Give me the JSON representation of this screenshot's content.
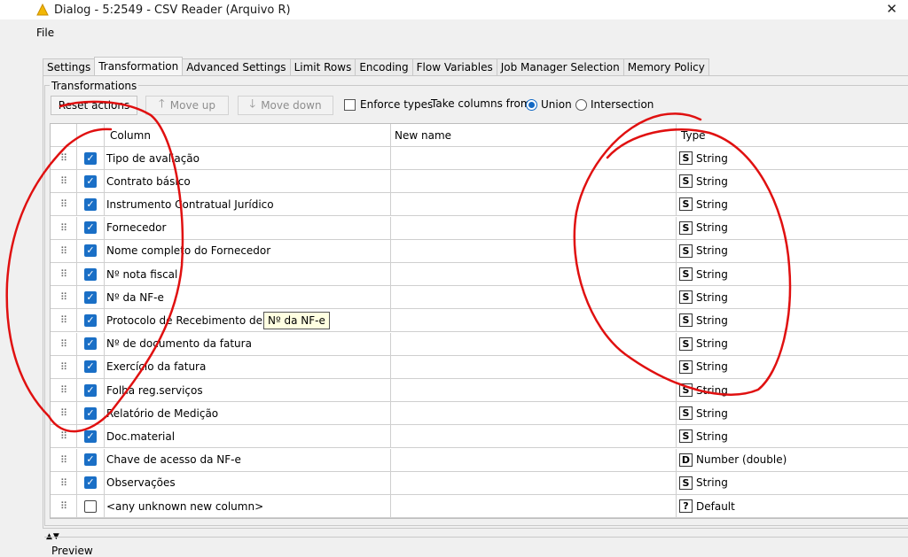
{
  "window": {
    "title": "Dialog - 5:2549 - CSV Reader (Arquivo R)",
    "close_label": "✕"
  },
  "menu": {
    "file": "File"
  },
  "tabs": [
    {
      "label": "Settings"
    },
    {
      "label": "Transformation",
      "active": true
    },
    {
      "label": "Advanced Settings"
    },
    {
      "label": "Limit Rows"
    },
    {
      "label": "Encoding"
    },
    {
      "label": "Flow Variables"
    },
    {
      "label": "Job Manager Selection"
    },
    {
      "label": "Memory Policy"
    }
  ],
  "transformations": {
    "group_title": "Transformations",
    "reset_label": "Reset actions",
    "move_up_label": "Move up",
    "move_down_label": "Move down",
    "enforce_types_label": "Enforce types",
    "enforce_types_checked": false,
    "take_columns_label": "Take columns from:",
    "union_label": "Union",
    "intersection_label": "Intersection",
    "selected_mode": "Union"
  },
  "table": {
    "headers": {
      "column": "Column",
      "new_name": "New name",
      "type": "Type"
    },
    "rows": [
      {
        "checked": true,
        "column": "Tipo de avaliação",
        "new_name": "",
        "type_icon": "S",
        "type": "String"
      },
      {
        "checked": true,
        "column": "Contrato básico",
        "new_name": "",
        "type_icon": "S",
        "type": "String"
      },
      {
        "checked": true,
        "column": "Instrumento Contratual Jurídico",
        "new_name": "",
        "type_icon": "S",
        "type": "String"
      },
      {
        "checked": true,
        "column": "Fornecedor",
        "new_name": "",
        "type_icon": "S",
        "type": "String"
      },
      {
        "checked": true,
        "column": "Nome completo do Fornecedor",
        "new_name": "",
        "type_icon": "S",
        "type": "String"
      },
      {
        "checked": true,
        "column": "Nº nota fiscal",
        "new_name": "",
        "type_icon": "S",
        "type": "String"
      },
      {
        "checked": true,
        "column": "Nº da NF-e",
        "new_name": "",
        "type_icon": "S",
        "type": "String"
      },
      {
        "checked": true,
        "column": "Protocolo de Recebimento de Nota",
        "new_name": "",
        "type_icon": "S",
        "type": "String"
      },
      {
        "checked": true,
        "column": "Nº de documento da fatura",
        "new_name": "",
        "type_icon": "S",
        "type": "String"
      },
      {
        "checked": true,
        "column": "Exercício da fatura",
        "new_name": "",
        "type_icon": "S",
        "type": "String"
      },
      {
        "checked": true,
        "column": "Folha reg.serviços",
        "new_name": "",
        "type_icon": "S",
        "type": "String"
      },
      {
        "checked": true,
        "column": "Relatório de Medição",
        "new_name": "",
        "type_icon": "S",
        "type": "String"
      },
      {
        "checked": true,
        "column": "Doc.material",
        "new_name": "",
        "type_icon": "S",
        "type": "String"
      },
      {
        "checked": true,
        "column": "Chave de acesso da NF-e",
        "new_name": "",
        "type_icon": "D",
        "type": "Number (double)"
      },
      {
        "checked": true,
        "column": "Observações",
        "new_name": "",
        "type_icon": "S",
        "type": "String"
      },
      {
        "checked": false,
        "column": "<any unknown new column>",
        "new_name": "",
        "type_icon": "?",
        "type": "Default"
      }
    ]
  },
  "tooltip": {
    "text": "Nº da NF-e"
  },
  "preview": {
    "title": "Preview"
  },
  "colors": {
    "checkbox": "#1a6fc6",
    "radio": "#1268c4",
    "annotation": "#e01010",
    "app_icon": "#f2b705"
  }
}
